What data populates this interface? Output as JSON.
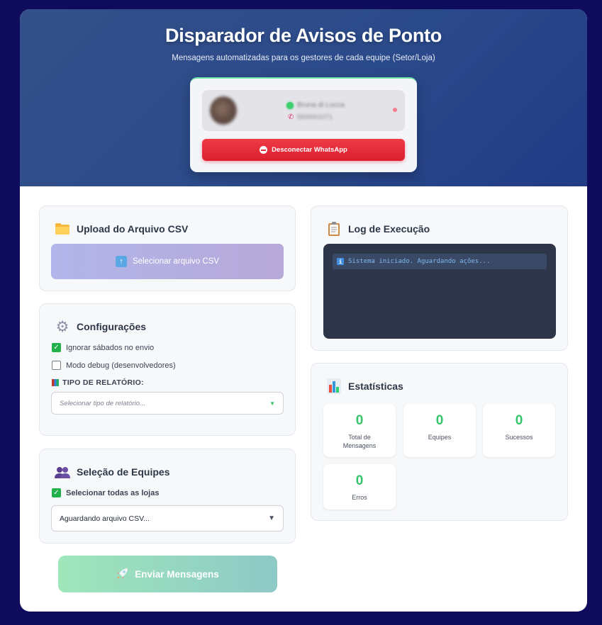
{
  "header": {
    "title": "Disparador de Avisos de Ponto",
    "subtitle": "Mensagens automatizadas para os gestores de cada equipe (Setor/Loja)"
  },
  "connection": {
    "profile_name": "Bruna di Lucca",
    "profile_phone": "5500001071",
    "disconnect_label": "Desconectar WhatsApp"
  },
  "upload": {
    "title": "Upload do Arquivo CSV",
    "button_label": "Selecionar arquivo CSV"
  },
  "config": {
    "title": "Configurações",
    "ignore_saturdays_label": "Ignorar sábados no envio",
    "ignore_saturdays_checked": true,
    "debug_label": "Modo debug (desenvolvedores)",
    "debug_checked": false,
    "report_type_label": "TIPO DE RELATÓRIO:",
    "report_type_placeholder": "Selecionar tipo de relatório..."
  },
  "teams": {
    "title": "Seleção de Equipes",
    "select_all_label": "Selecionar todas as lojas",
    "select_all_checked": true,
    "teams_select_value": "Aguardando arquivo CSV..."
  },
  "send": {
    "label": "Enviar Mensagens"
  },
  "log": {
    "title": "Log de Execução",
    "lines": [
      "Sistema iniciado. Aguardando ações..."
    ]
  },
  "stats": {
    "title": "Estatísticas",
    "items": [
      {
        "value": "0",
        "label": "Total de Mensagens"
      },
      {
        "value": "0",
        "label": "Equipes"
      },
      {
        "value": "0",
        "label": "Sucessos"
      },
      {
        "value": "0",
        "label": "Erros"
      }
    ]
  },
  "colors": {
    "background": "#0f0c5e",
    "accent_green": "#36c56a",
    "danger_red": "#dc1f2f"
  }
}
